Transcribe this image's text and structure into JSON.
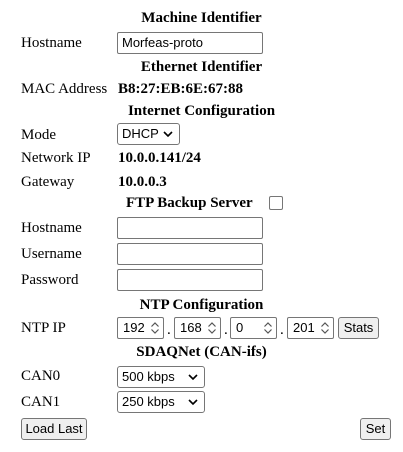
{
  "machine": {
    "heading": "Machine Identifier",
    "hostname_label": "Hostname",
    "hostname_value": "Morfeas-proto"
  },
  "ethernet": {
    "heading": "Ethernet Identifier",
    "mac_label": "MAC Address",
    "mac_value": "B8:27:EB:6E:67:88"
  },
  "internet": {
    "heading": "Internet Configuration",
    "mode_label": "Mode",
    "mode_value": "DHCP",
    "ip_label": "Network IP",
    "ip_value": "10.0.0.141/24",
    "gateway_label": "Gateway",
    "gateway_value": "10.0.0.3"
  },
  "ftp": {
    "heading": "FTP Backup Server",
    "enabled": false,
    "hostname_label": "Hostname",
    "username_label": "Username",
    "password_label": "Password",
    "hostname_value": "",
    "username_value": "",
    "password_value": ""
  },
  "ntp": {
    "heading": "NTP Configuration",
    "ip_label": "NTP IP",
    "octets": [
      "192",
      "168",
      "0",
      "201"
    ],
    "stats_label": "Stats"
  },
  "sdaqnet": {
    "heading": "SDAQNet (CAN-ifs)",
    "can0_label": "CAN0",
    "can0_value": "500 kbps",
    "can1_label": "CAN1",
    "can1_value": "250 kbps"
  },
  "actions": {
    "load_last_label": "Load Last",
    "set_label": "Set"
  }
}
